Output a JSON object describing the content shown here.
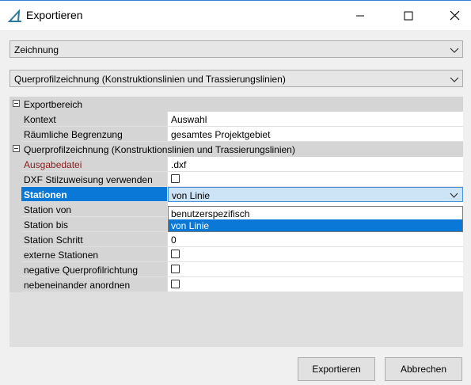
{
  "window": {
    "title": "Exportieren"
  },
  "combo1": {
    "value": "Zeichnung"
  },
  "combo2": {
    "value": "Querprofilzeichnung (Konstruktionslinien und Trassierungslinien)"
  },
  "grid": {
    "cat1": "Exportbereich",
    "kontext_label": "Kontext",
    "kontext_value": "Auswahl",
    "raeumlich_label": "Räumliche Begrenzung",
    "raeumlich_value": "gesamtes Projektgebiet",
    "cat2": "Querprofilzeichnung (Konstruktionslinien und Trassierungslinien)",
    "ausgabe_label": "Ausgabedatei",
    "ausgabe_value": ".dxf",
    "dxf_label": "DXF Stilzuweisung verwenden",
    "stationen_label": "Stationen",
    "stationen_value": "von Linie",
    "station_von_label": "Station von",
    "station_bis_label": "Station bis",
    "station_schritt_label": "Station Schritt",
    "station_schritt_value": "0",
    "externe_label": "externe Stationen",
    "negative_label": "negative Querprofilrichtung",
    "nebeneinander_label": "nebeneinander anordnen"
  },
  "dropdown": {
    "options": [
      "benutzerspezifisch",
      "von Linie"
    ],
    "selected": "von Linie"
  },
  "buttons": {
    "export": "Exportieren",
    "cancel": "Abbrechen"
  },
  "colors": {
    "accent": "#0a78d7",
    "error_label": "#8b1a1a"
  }
}
